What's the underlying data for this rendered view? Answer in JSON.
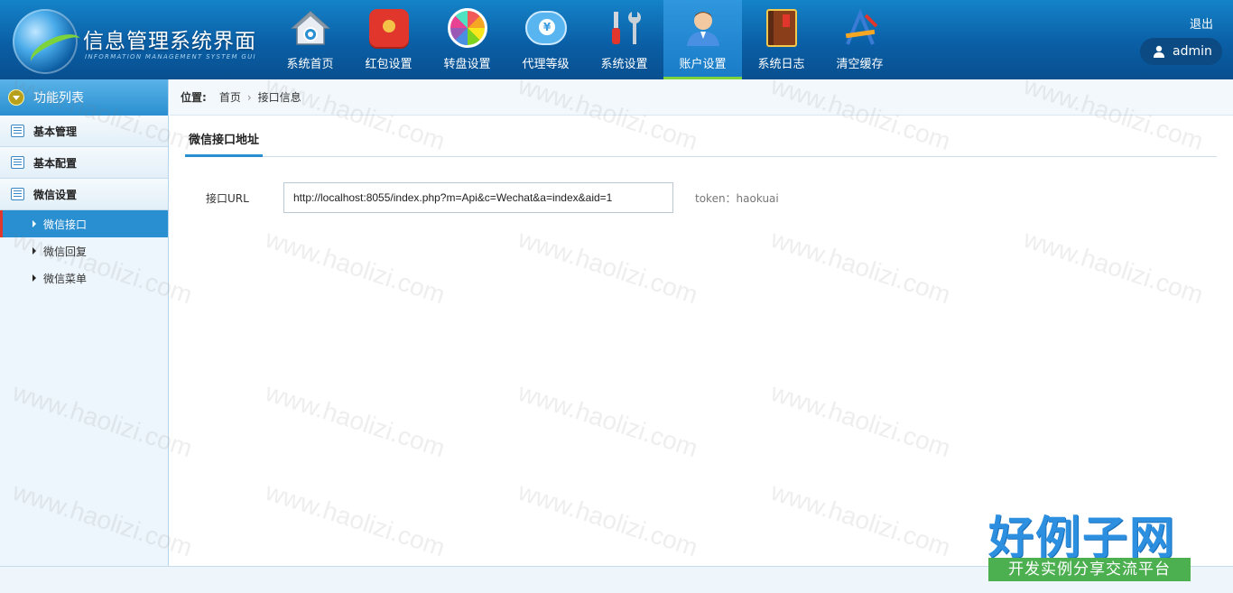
{
  "header": {
    "title": "信息管理系统界面",
    "subtitle": "INFORMATION MANAGEMENT SYSTEM GUI",
    "logout_label": "退出",
    "user_name": "admin",
    "nav": [
      {
        "label": "系统首页",
        "icon": "home-icon"
      },
      {
        "label": "红包设置",
        "icon": "red-packet-icon"
      },
      {
        "label": "转盘设置",
        "icon": "wheel-icon"
      },
      {
        "label": "代理等级",
        "icon": "yen-cloud-icon"
      },
      {
        "label": "系统设置",
        "icon": "tools-icon"
      },
      {
        "label": "账户设置",
        "icon": "user-icon"
      },
      {
        "label": "系统日志",
        "icon": "book-icon"
      },
      {
        "label": "清空缓存",
        "icon": "clean-icon"
      }
    ],
    "active_index": 5,
    "accent_color": "#7dd33c"
  },
  "sidebar": {
    "title": "功能列表",
    "sections": [
      {
        "label": "基本管理"
      },
      {
        "label": "基本配置"
      },
      {
        "label": "微信设置"
      }
    ],
    "sub_items": [
      {
        "label": "微信接口"
      },
      {
        "label": "微信回复"
      },
      {
        "label": "微信菜单"
      }
    ]
  },
  "breadcrumb": {
    "label": "位置:",
    "items": [
      "首页",
      "接口信息"
    ],
    "separator": "›"
  },
  "main": {
    "tab_label": "微信接口地址",
    "field_label": "接口URL",
    "field_value": "http://localhost:8055/index.php?m=Api&c=Wechat&a=index&aid=1",
    "token_hint": "token：haokuai"
  },
  "watermark": {
    "text": "www.haolizi.com",
    "brand_main": "好例子网",
    "brand_sub": "开发实例分享交流平台"
  }
}
